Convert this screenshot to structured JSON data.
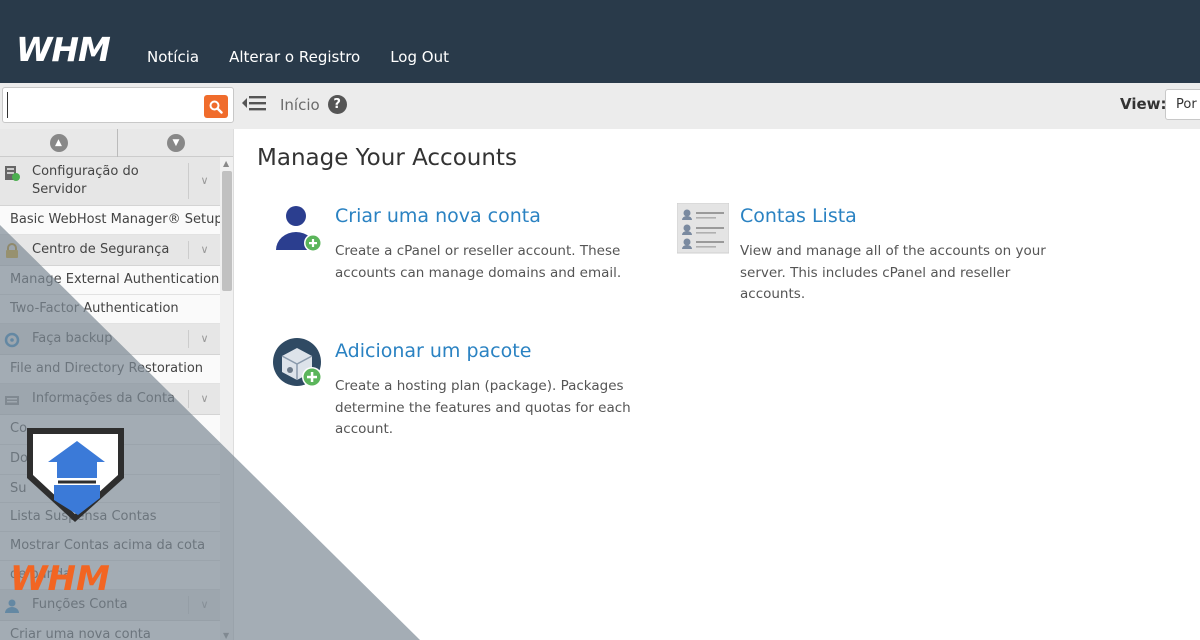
{
  "header": {
    "logo_text": "WHM",
    "nav": [
      "Notícia",
      "Alterar o Registro",
      "Log Out"
    ]
  },
  "search": {
    "placeholder": ""
  },
  "breadcrumb": {
    "home": "Início"
  },
  "view": {
    "label": "View:",
    "selected": "Por"
  },
  "sidebar": {
    "categories": [
      {
        "label": "Configuração do Servidor",
        "icon": "server-icon",
        "items": [
          "Basic WebHost Manager® Setup"
        ]
      },
      {
        "label": "Centro de Segurança",
        "icon": "lock-icon",
        "items": [
          "Manage External Authentications",
          "Two-Factor Authentication"
        ]
      },
      {
        "label": "Faça backup",
        "icon": "backup-icon",
        "items": [
          "File and Directory Restoration"
        ]
      },
      {
        "label": "Informações da Conta",
        "icon": "account-info-icon",
        "items": [
          "Co",
          "Do    ados lista",
          "Su",
          "Lista Suspensa Contas",
          "Mostrar Contas acima da cota",
          "                de banda"
        ]
      },
      {
        "label": "Funções Conta",
        "icon": "user-icon",
        "items": [
          "Criar uma nova conta"
        ]
      }
    ]
  },
  "main": {
    "title": "Manage Your Accounts",
    "cards": [
      {
        "title": "Criar uma nova conta",
        "desc": "Create a cPanel or reseller account. These accounts can manage domains and email."
      },
      {
        "title": "Contas Lista",
        "desc": "View and manage all of the accounts on your server. This includes cPanel and reseller accounts."
      },
      {
        "title": "Adicionar um pacote",
        "desc": "Create a hosting plan (package). Packages determine the features and quotas for each account."
      }
    ]
  },
  "watermark": {
    "logo_text": "WHM"
  },
  "colors": {
    "topbar": "#293a4a",
    "accent": "#2a82c2",
    "search_button": "#f06c2c",
    "watermark_logo": "#f26522"
  }
}
